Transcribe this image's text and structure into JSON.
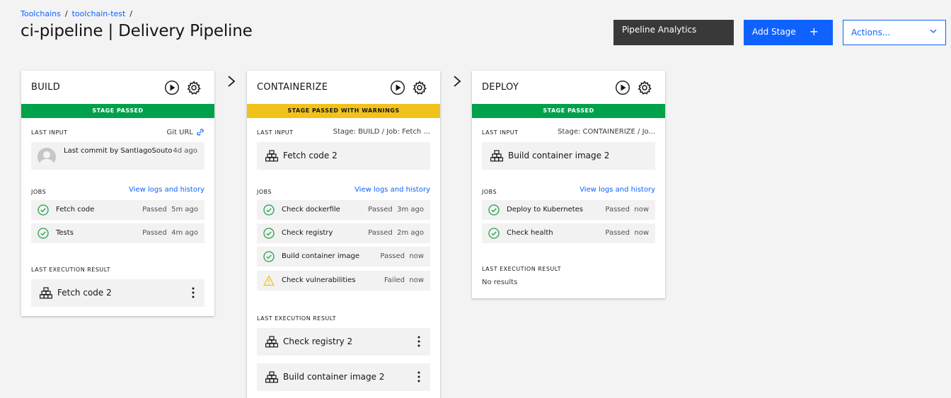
{
  "breadcrumb": {
    "item1": "Toolchains",
    "item2": "toolchain-test",
    "sep": "/"
  },
  "title": "ci-pipeline | Delivery Pipeline",
  "header": {
    "analytics": "Pipeline Analytics",
    "add_stage": "Add Stage",
    "add_icon": "+",
    "actions": "Actions..."
  },
  "labels": {
    "last_input": "LAST INPUT",
    "jobs": "JOBS",
    "view_logs": "View logs and history",
    "last_result": "LAST EXECUTION RESULT",
    "no_results": "No results"
  },
  "stages": [
    {
      "name": "BUILD",
      "status": "STAGE PASSED",
      "input_right": "Git URL",
      "commit_text": "Last commit by SantiagoSouto",
      "commit_time": "4d ago",
      "jobs": [
        {
          "name": "Fetch code",
          "status": "Passed",
          "time": "5m ago"
        },
        {
          "name": "Tests",
          "status": "Passed",
          "time": "4m ago"
        }
      ],
      "results": [
        "Fetch code 2"
      ]
    },
    {
      "name": "CONTAINERIZE",
      "status": "STAGE PASSED WITH WARNINGS",
      "input_right": "Stage: BUILD  /  Job: Fetch ...",
      "input_job": "Fetch code 2",
      "jobs": [
        {
          "name": "Check dockerfile",
          "status": "Passed",
          "time": "3m ago"
        },
        {
          "name": "Check registry",
          "status": "Passed",
          "time": "2m ago"
        },
        {
          "name": "Build container image",
          "status": "Passed",
          "time": "now"
        },
        {
          "name": "Check vulnerabilities",
          "status": "Failed",
          "time": "now"
        }
      ],
      "results": [
        "Check registry 2",
        "Build container image 2"
      ]
    },
    {
      "name": "DEPLOY",
      "status": "STAGE PASSED",
      "input_right": "Stage: CONTAINERIZE  /  Jo...",
      "input_job": "Build container image 2",
      "jobs": [
        {
          "name": "Deploy to Kubernetes",
          "status": "Passed",
          "time": "now"
        },
        {
          "name": "Check health",
          "status": "Passed",
          "time": "now"
        }
      ]
    }
  ],
  "colors": {
    "pass": "#00a14b",
    "warn": "#f1c21b",
    "primary": "#0f62fe",
    "dark": "#393939"
  }
}
